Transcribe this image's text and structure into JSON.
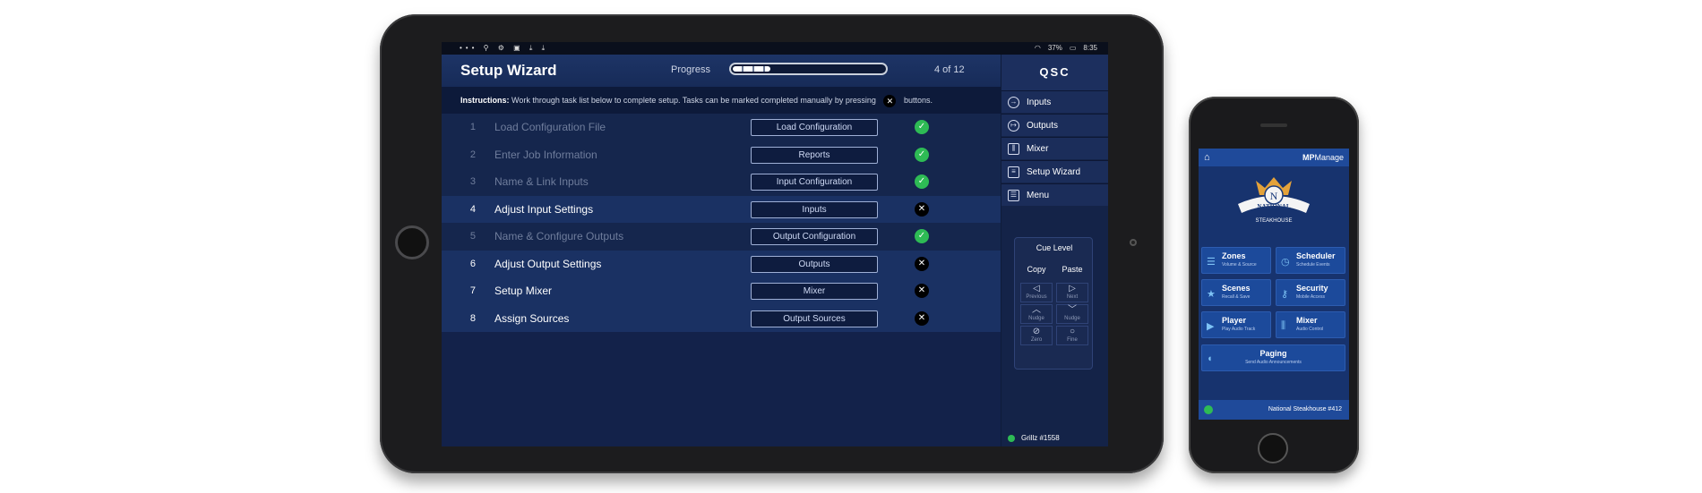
{
  "tablet": {
    "statusbar": {
      "left_icons": "••• ⚲ ⚙ ▣ ⤓ ⤓",
      "battery": "37%",
      "time": "8:35"
    },
    "title": "Setup Wizard",
    "progress": {
      "label": "Progress",
      "count": "4 of 12",
      "fraction": 0.25
    },
    "instructions": {
      "lead": "Instructions:",
      "text": "Work through task list below to complete setup.  Tasks can be marked completed manually by pressing",
      "x_glyph": "✕",
      "tail": "buttons."
    },
    "tasks": [
      {
        "num": "1",
        "label": "Load Configuration File",
        "button": "Load Configuration",
        "done": true
      },
      {
        "num": "2",
        "label": "Enter Job Information",
        "button": "Reports",
        "done": true
      },
      {
        "num": "3",
        "label": "Name & Link Inputs",
        "button": "Input Configuration",
        "done": true
      },
      {
        "num": "4",
        "label": "Adjust Input Settings",
        "button": "Inputs",
        "done": false
      },
      {
        "num": "5",
        "label": "Name & Configure Outputs",
        "button": "Output Configuration",
        "done": true
      },
      {
        "num": "6",
        "label": "Adjust Output Settings",
        "button": "Outputs",
        "done": false
      },
      {
        "num": "7",
        "label": "Setup Mixer",
        "button": "Mixer",
        "done": false
      },
      {
        "num": "8",
        "label": "Assign Sources",
        "button": "Output Sources",
        "done": false
      }
    ],
    "sidebar": {
      "logo": "QSC",
      "nav": [
        {
          "label": "Inputs",
          "icon": "input-icon"
        },
        {
          "label": "Outputs",
          "icon": "output-icon"
        },
        {
          "label": "Mixer",
          "icon": "mixer-icon"
        },
        {
          "label": "Setup Wizard",
          "icon": "clipboard-icon"
        },
        {
          "label": "Menu",
          "icon": "menu-icon"
        }
      ],
      "cue": {
        "level": "Cue Level",
        "copy": "Copy",
        "paste": "Paste",
        "previous": "Previous",
        "next": "Next",
        "nudge_up": "Nudge",
        "nudge_down": "Nudge",
        "zero": "Zero",
        "fine": "Fine"
      },
      "device": "Grillz #1558"
    },
    "colors": {
      "ok": "#2ebb55",
      "accent": "#1a3163"
    }
  },
  "phone": {
    "brand_bold": "MP",
    "brand": "Manage",
    "logo_text": "NATIONAL",
    "logo_sub": "STEAKHOUSE",
    "tiles": [
      {
        "title": "Zones",
        "sub": "Volume & Source",
        "icon": "list-icon"
      },
      {
        "title": "Scheduler",
        "sub": "Schedule Events",
        "icon": "clock-icon"
      },
      {
        "title": "Scenes",
        "sub": "Recall & Save",
        "icon": "star-icon"
      },
      {
        "title": "Security",
        "sub": "Mobile Access",
        "icon": "key-icon"
      },
      {
        "title": "Player",
        "sub": "Play Audio Track",
        "icon": "play-icon"
      },
      {
        "title": "Mixer",
        "sub": "Audio Control",
        "icon": "mixer-icon"
      }
    ],
    "paging": {
      "title": "Paging",
      "sub": "Send Audio Announcements"
    },
    "venue": "National Steakhouse #412"
  }
}
